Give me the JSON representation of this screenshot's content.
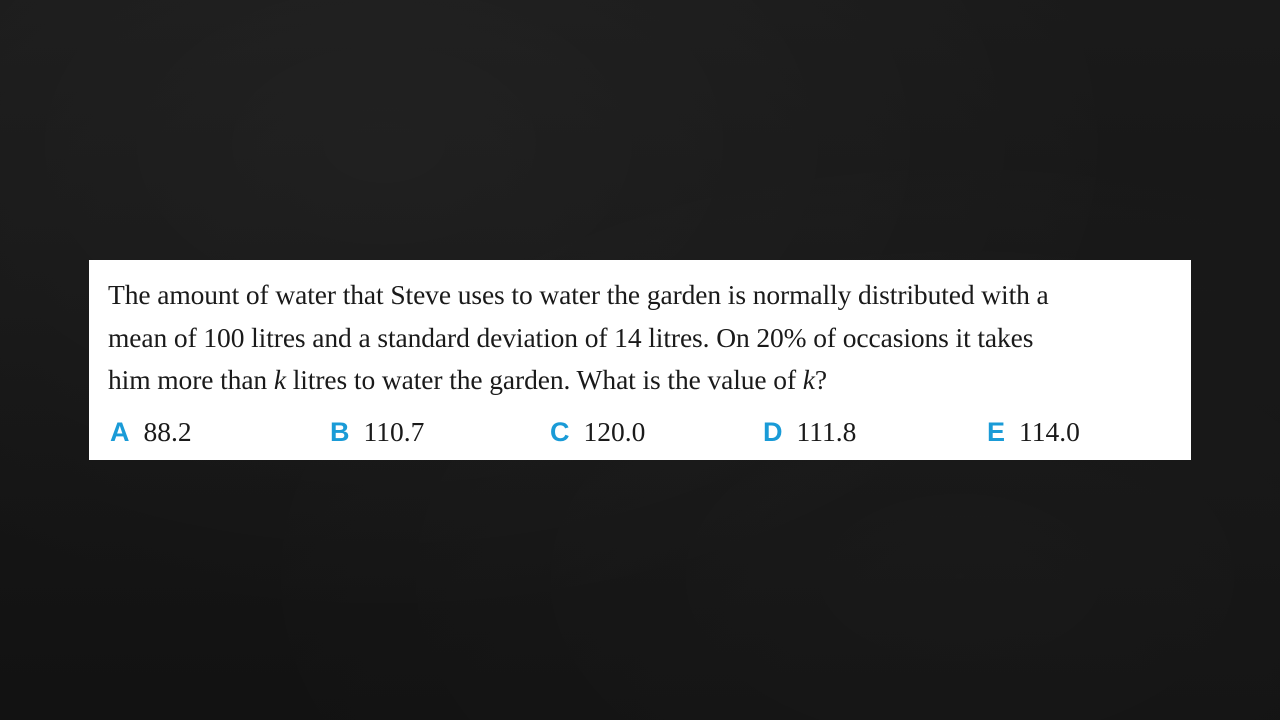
{
  "question": {
    "line1_text": "The amount of water that Steve uses to water the garden is normally distributed with a",
    "line2_text": "mean of 100 litres and a standard deviation of 14 litres. On 20% of occasions it takes",
    "line3_before": "him more than ",
    "line3_var1": "k",
    "line3_middle": " litres to water the garden. What is the value of ",
    "line3_var2": "k",
    "line3_after": "?"
  },
  "options": [
    {
      "letter": "A",
      "value": "88.2"
    },
    {
      "letter": "B",
      "value": "110.7"
    },
    {
      "letter": "C",
      "value": "120.0"
    },
    {
      "letter": "D",
      "value": "111.8"
    },
    {
      "letter": "E",
      "value": "114.0"
    }
  ],
  "colors": {
    "accent": "#1a9bd7",
    "card_background": "#ffffff",
    "page_background": "#161616"
  }
}
